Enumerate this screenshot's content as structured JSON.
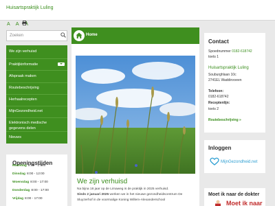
{
  "site": {
    "name": "Huisartspraktijk Luling"
  },
  "font_sizes": [
    "A",
    "A",
    "A"
  ],
  "icons": {
    "print": "print-icon",
    "search": "search-icon",
    "home": "home-icon",
    "nav_toggle": "chevron-down-icon",
    "mgn_logo": "mijngezondheid-logo",
    "doctor": "doctor-icon"
  },
  "search": {
    "placeholder": "Zoeken"
  },
  "nav": {
    "items": [
      {
        "label": "We zijn verhuisd"
      },
      {
        "label": "Praktijkinformatie"
      },
      {
        "label": "Afspraak maken"
      },
      {
        "label": "Routebeschrijving"
      },
      {
        "label": "Herhaalrecepten"
      },
      {
        "label": "MijnGezondheid.net"
      },
      {
        "label": "Elektronisch medische gegevens delen"
      },
      {
        "label": "Nieuws"
      }
    ]
  },
  "hours": {
    "title": "Openingstijden",
    "rows": [
      {
        "day": "Maandag",
        "time": "8:00 - 17:00"
      },
      {
        "day": "Dinsdag",
        "time": "8:00 - 12:00"
      },
      {
        "day": "Woensdag",
        "time": "8:00 - 17:00"
      },
      {
        "day": "Donderdag",
        "time": "8:00 - 17:00"
      },
      {
        "day": "Vrijdag",
        "time": "8:00 - 17:00"
      }
    ]
  },
  "breadcrumb": {
    "home": "Home"
  },
  "article": {
    "title": "We zijn verhuisd",
    "lines": [
      "Na bijna 18 jaar op de Limaweg is de praktijk in 2025 verhuisd.",
      "Sinds 2 januari 2025 werken we in het nieuwe gezondheidscentrum De",
      "Sluyzerhof in de voormalige Koning Willem-Alexanderschool"
    ],
    "bold_prefix": "Sinds 2 januari 2025"
  },
  "contact": {
    "title": "Contact",
    "phone_label": "Spoednummer",
    "phone": "0182-618742",
    "phone_ext": "toets 1",
    "practice": "Huisartspraktijk Luling",
    "street": "Souburghlaan 10c",
    "city": "2741EL Waddinxveen",
    "tel_label": "Telefoon:",
    "tel": "0182-618742",
    "recept_label": "Receptenlijn:",
    "recept": "toets 2",
    "route_link": "Routebeschrijving »"
  },
  "login": {
    "title": "Inloggen",
    "mgn": "MijnGezondheid.net"
  },
  "must": {
    "title": "Moet ik naar de dokter",
    "banner": "Moet ik naar"
  },
  "colors": {
    "green": "#3f8f1f",
    "link_green": "#3a8e1c",
    "red": "#c02b2b",
    "blue": "#2f9fd2"
  }
}
